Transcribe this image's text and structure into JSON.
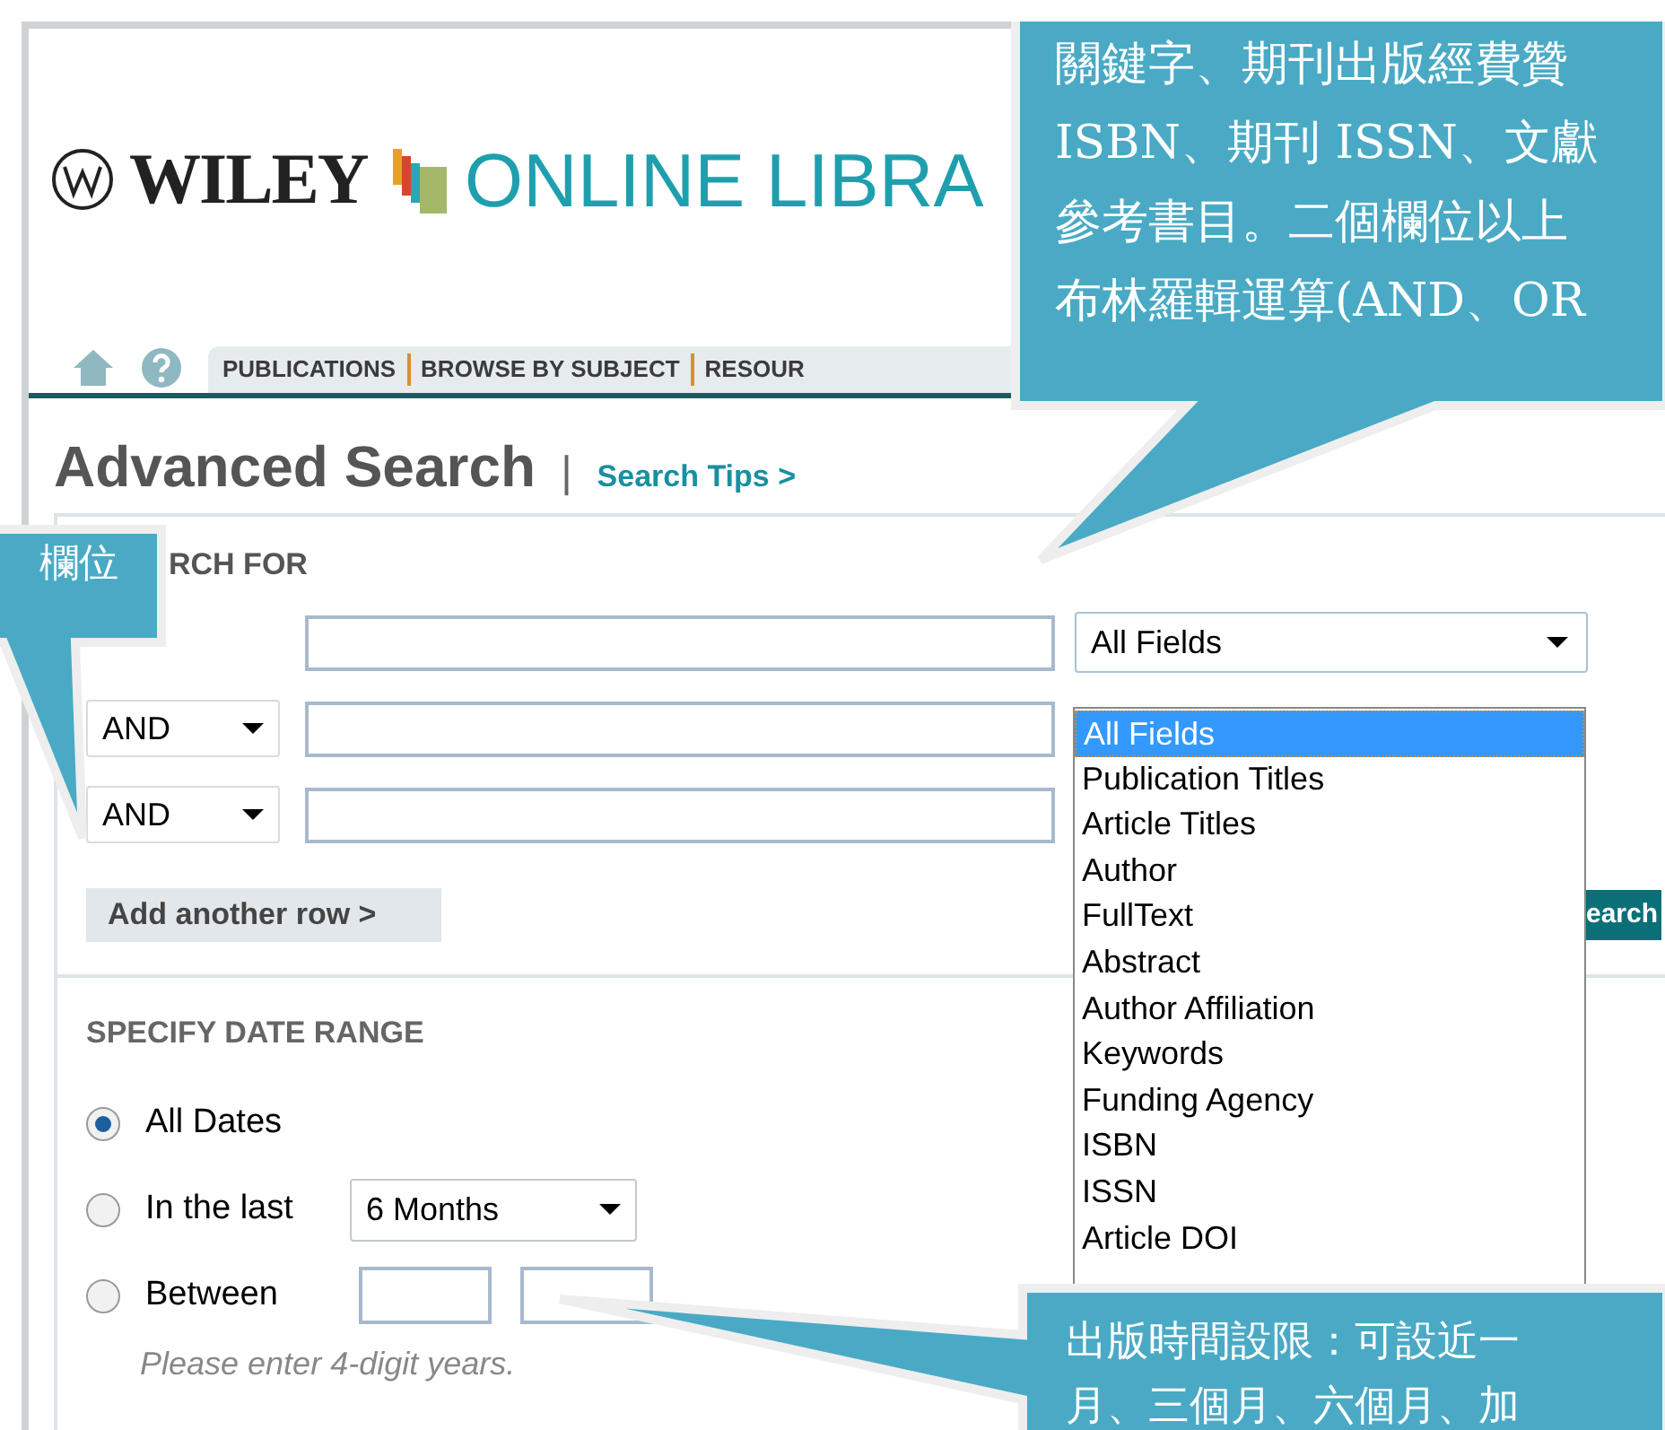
{
  "header": {
    "brand": "WILEY",
    "library": "ONLINE LIBRA"
  },
  "nav": {
    "items": [
      {
        "label": "PUBLICATIONS"
      },
      {
        "label": "BROWSE BY SUBJECT"
      },
      {
        "label": "RESOUR"
      }
    ]
  },
  "page_title": "Advanced Search",
  "title_divider": "|",
  "search_tips": "Search Tips >",
  "search_for": {
    "heading": "RCH FOR",
    "rows": [
      {},
      {
        "operator": "AND"
      },
      {
        "operator": "AND"
      }
    ],
    "field_select": {
      "value": "All Fields",
      "expanded": true,
      "options": [
        {
          "label": "All Fields",
          "selected": true
        },
        {
          "label": "Publication Titles",
          "selected": false
        },
        {
          "label": "Article Titles",
          "selected": false
        },
        {
          "label": "Author",
          "selected": false
        },
        {
          "label": "FullText",
          "selected": false
        },
        {
          "label": "Abstract",
          "selected": false
        },
        {
          "label": "Author Affiliation",
          "selected": false
        },
        {
          "label": "Keywords",
          "selected": false
        },
        {
          "label": "Funding Agency",
          "selected": false
        },
        {
          "label": "ISBN",
          "selected": false
        },
        {
          "label": "ISSN",
          "selected": false
        },
        {
          "label": "Article DOI",
          "selected": false
        }
      ]
    },
    "add_row": "Add another row >",
    "search_button": "earch"
  },
  "date_range": {
    "heading": "SPECIFY DATE RANGE",
    "options": [
      {
        "kind": "all",
        "label": "All Dates",
        "selected": true
      },
      {
        "kind": "last",
        "label": "In the last",
        "value": "6 Months",
        "selected": false
      },
      {
        "kind": "between",
        "label": "Between",
        "selected": false
      }
    ],
    "hint": "Please enter 4-digit years."
  },
  "callouts": [
    {
      "lines": [
        "關鍵字、期刊出版經費贊",
        "ISBN、期刊 ISSN、文獻",
        "參考書目。二個欄位以上",
        "布林羅輯運算(AND、OR"
      ]
    },
    {
      "lines": [
        "欄位"
      ]
    },
    {
      "lines": [
        "出版時間設限：可設近一",
        "月、三個月、六個月、加"
      ]
    }
  ]
}
